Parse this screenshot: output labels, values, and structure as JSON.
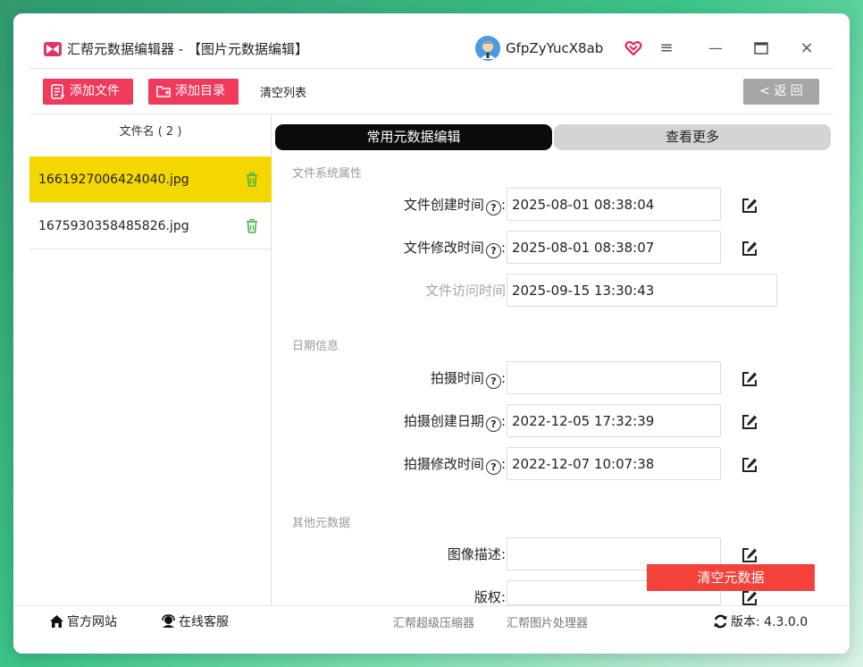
{
  "window": {
    "title": "汇帮元数据编辑器 - 【图片元数据编辑】",
    "username": "GfpZyYucX8ab",
    "menu_glyph": "≡",
    "minimize_glyph": "—",
    "maximize_glyph": "☐",
    "close_glyph": "×"
  },
  "toolbar": {
    "add_file": "添加文件",
    "add_folder": "添加目录",
    "clear_list": "清空列表",
    "back": "< 返 回"
  },
  "file_list": {
    "header": "文件名 ( 2 )",
    "files": [
      {
        "name": "1661927006424040.jpg",
        "selected": true
      },
      {
        "name": "1675930358485826.jpg",
        "selected": false
      }
    ]
  },
  "tabs": {
    "common": "常用元数据编辑",
    "more": "查看更多"
  },
  "sections": {
    "filesystem": "文件系统属性",
    "date": "日期信息",
    "other": "其他元数据"
  },
  "fields": {
    "created": {
      "label": "文件创建时间",
      "value": "2025-08-01 08:38:04"
    },
    "modified": {
      "label": "文件修改时间",
      "value": "2025-08-01 08:38:07"
    },
    "accessed": {
      "label": "文件访问时间",
      "value": "2025-09-15 13:30:43"
    },
    "shot_time": {
      "label": "拍摄时间",
      "value": ""
    },
    "shot_created": {
      "label": "拍摄创建日期",
      "value": "2022-12-05 17:32:39"
    },
    "shot_modified": {
      "label": "拍摄修改时间",
      "value": "2022-12-07 10:07:38"
    },
    "description": {
      "label": "图像描述",
      "value": ""
    },
    "copyright": {
      "label": "版权",
      "value": ""
    }
  },
  "help_glyph": "?",
  "colon": ":",
  "clear_metadata": "清空元数据",
  "footer": {
    "website": "官方网站",
    "support": "在线客服",
    "compressor": "汇帮超级压缩器",
    "image_processor": "汇帮图片处理器",
    "version": "版本: 4.3.0.0"
  },
  "colors": {
    "accent_pink": "#ef3a5c",
    "selected_row": "#f4d600",
    "danger_red": "#f3423a",
    "tab_active": "#0b0b0b"
  }
}
